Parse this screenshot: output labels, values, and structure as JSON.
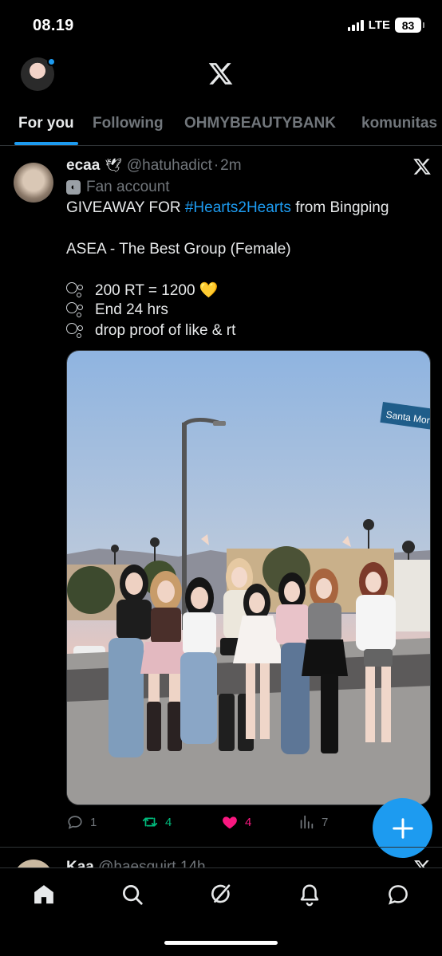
{
  "status_bar": {
    "time": "08.19",
    "network": "LTE",
    "battery": "83"
  },
  "header": {
    "logo": "x-logo-icon",
    "avatar_notification": true
  },
  "tabs": [
    {
      "label": "For you",
      "active": true
    },
    {
      "label": "Following",
      "active": false
    },
    {
      "label": "OHMYBEAUTYBANK",
      "active": false
    },
    {
      "label": "komunitas",
      "active": false
    }
  ],
  "tweet": {
    "display_name": "ecaa",
    "name_emoji": "🕊",
    "handle": "@hatuhadict",
    "separator": "·",
    "time": "2m",
    "badge_label": "Fan account",
    "text_line1_prefix": "GIVEAWAY FOR ",
    "hashtag": "#Hearts2Hearts",
    "text_line1_suffix": " from Bingping",
    "text_line2": "ASEA - The Best Group (Female)",
    "bullets": [
      {
        "text": "200 RT = 1200 💛"
      },
      {
        "text": "End 24 hrs"
      },
      {
        "text": "drop proof of like & rt"
      }
    ],
    "photo": {
      "street_sign": "Santa Moni"
    },
    "actions": {
      "replies": "1",
      "retweets": "4",
      "likes": "4",
      "views": "7"
    }
  },
  "next_tweet_peek": {
    "display_name": "Kaa",
    "handle": "@haesquirt",
    "time": "14h"
  },
  "colors": {
    "accent": "#1d9bf0",
    "retweet": "#00ba7c",
    "like": "#f91880",
    "muted": "#71767b",
    "divider": "#2f3336"
  },
  "bottom_nav": [
    "home-icon",
    "search-icon",
    "grok-icon",
    "notifications-icon",
    "messages-icon"
  ]
}
